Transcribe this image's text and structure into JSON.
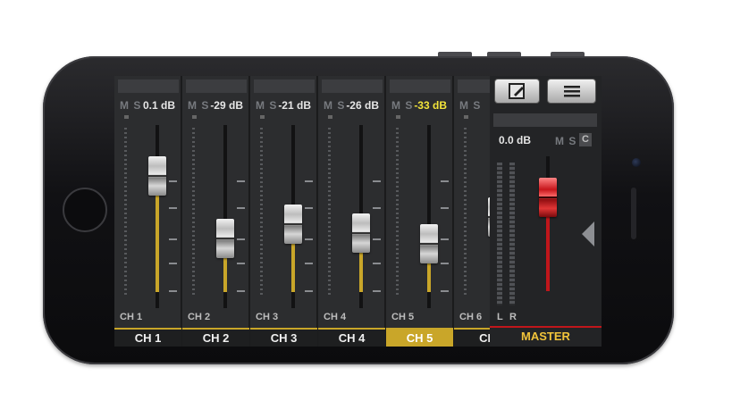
{
  "channels": [
    {
      "db": "0.1 dB",
      "label": "CH 1",
      "button": "CH 1",
      "level": 0.72,
      "highlight": false,
      "active": false
    },
    {
      "db": "-29 dB",
      "label": "CH 2",
      "button": "CH 2",
      "level": 0.38,
      "highlight": false,
      "active": false
    },
    {
      "db": "-21 dB",
      "label": "CH 3",
      "button": "CH 3",
      "level": 0.46,
      "highlight": false,
      "active": false
    },
    {
      "db": "-26 dB",
      "label": "CH 4",
      "button": "CH 4",
      "level": 0.41,
      "highlight": false,
      "active": false
    },
    {
      "db": "-33 dB",
      "label": "CH 5",
      "button": "CH 5",
      "level": 0.35,
      "highlight": true,
      "active": true
    },
    {
      "db": "-",
      "label": "CH 6",
      "button": "CH",
      "level": 0.5,
      "highlight": false,
      "active": false
    }
  ],
  "ms_label": "M S",
  "master": {
    "db": "0.0 dB",
    "ms": "M S",
    "c": "C",
    "left": "L",
    "right": "R",
    "label": "MASTER",
    "edit_icon": "edit-icon",
    "menu_icon": "menu-icon"
  },
  "colors": {
    "accent": "#c9a629",
    "master_accent": "#c0161b",
    "highlight_text": "#f3e53a"
  }
}
